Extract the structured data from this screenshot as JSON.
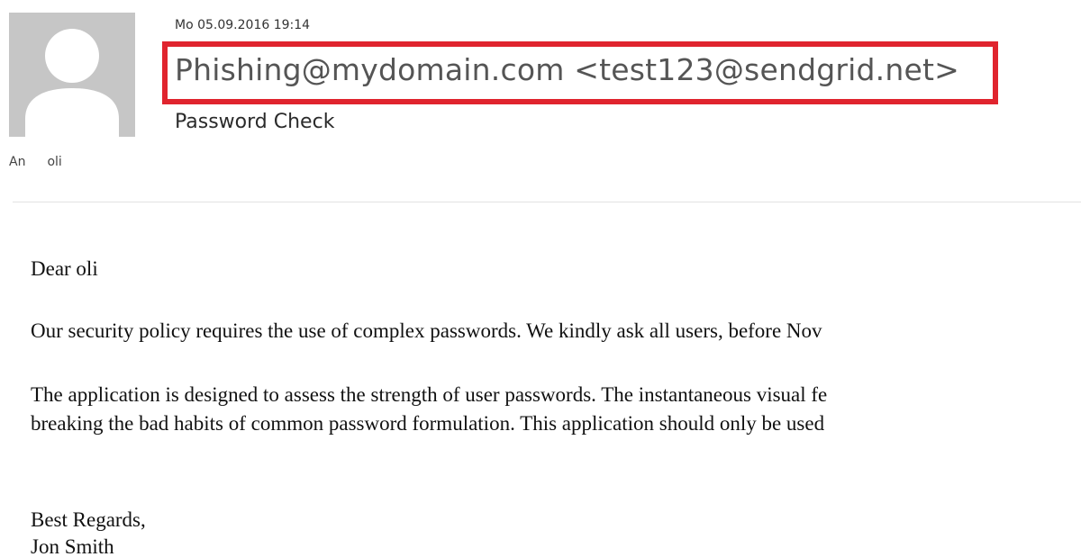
{
  "email": {
    "datetime": "Mo 05.09.2016 19:14",
    "sender": "Phishing@mydomain.com <test123@sendgrid.net>",
    "subject": "Password Check",
    "to_label": "An",
    "to_value": "oli",
    "highlight_color": "#e0242e"
  },
  "body": {
    "greeting": "Dear oli",
    "paragraph1": "Our security policy requires the use of complex passwords. We kindly ask all users, before Nov",
    "paragraph2_line1": "The application is designed to assess the strength of user passwords. The instantaneous visual fe",
    "paragraph2_line2": "breaking the bad habits of common password formulation. This application should only be used",
    "closing": "Best Regards,",
    "signature": "Jon Smith"
  },
  "icons": {
    "avatar": "default-user-avatar-icon"
  }
}
